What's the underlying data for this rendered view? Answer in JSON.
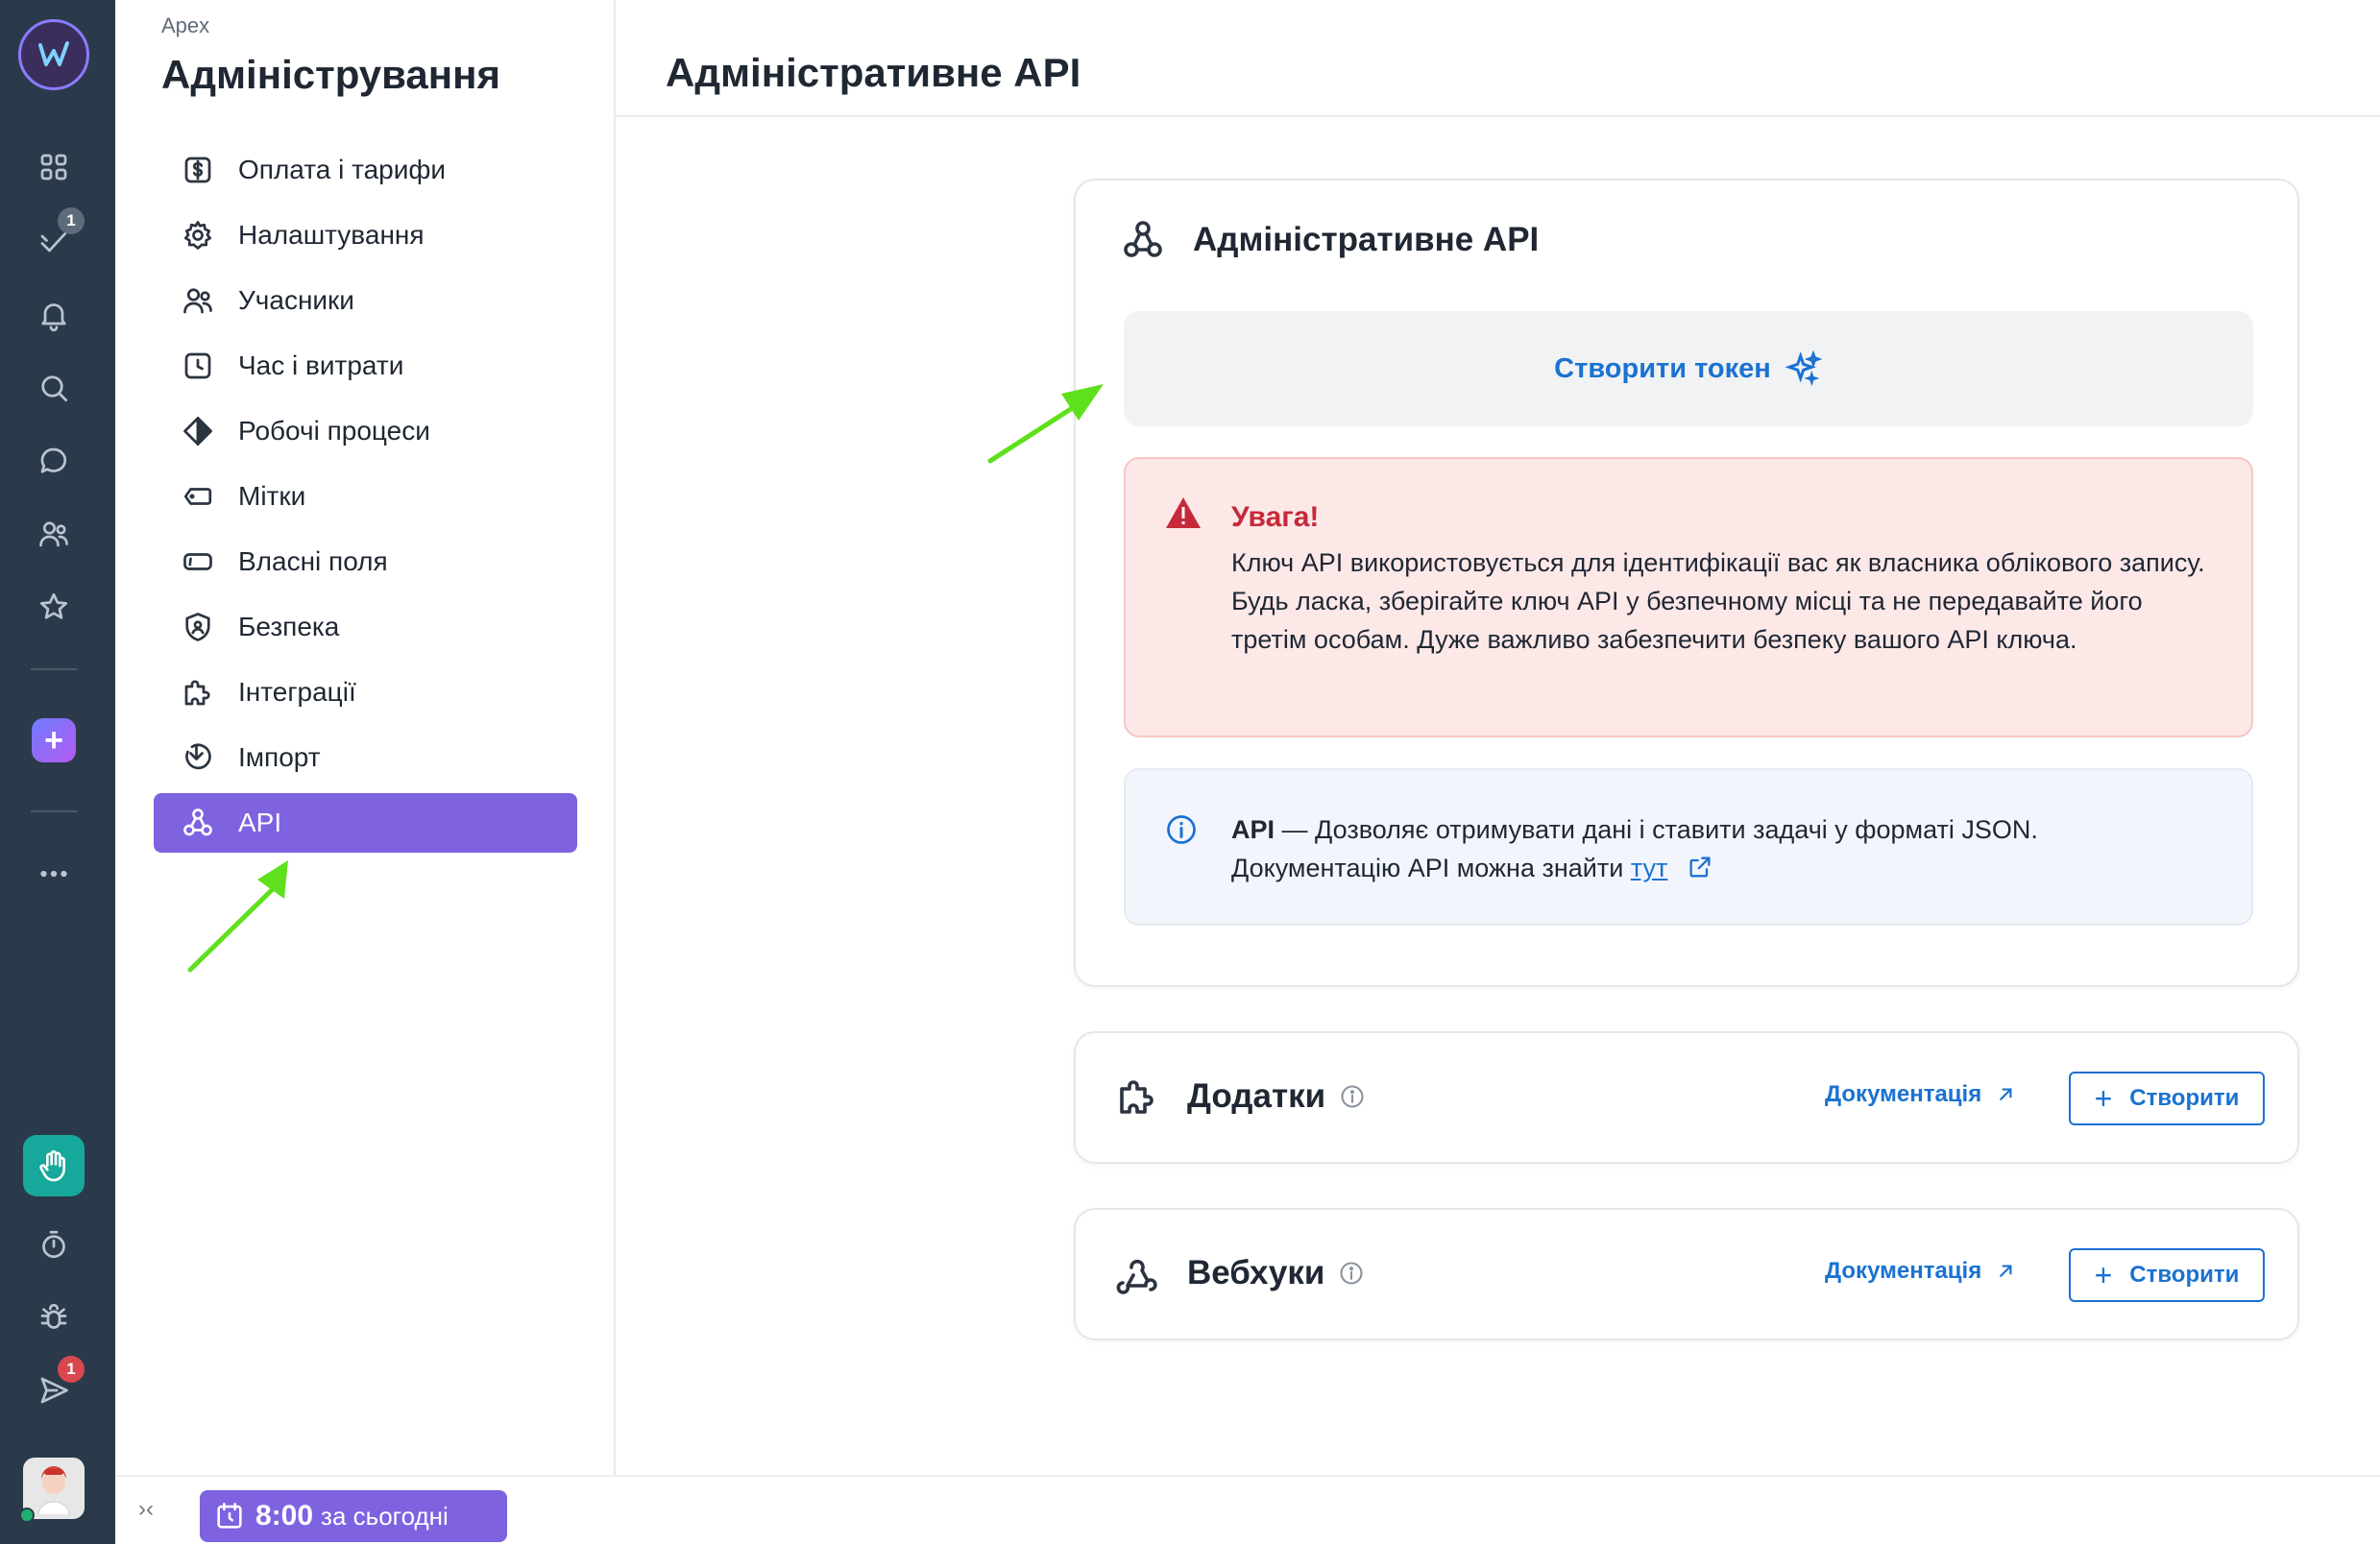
{
  "rail": {
    "badge_tasks": "1",
    "badge_inbox": "1"
  },
  "sidebar": {
    "workspace": "Apex",
    "title": "Адміністрування",
    "items": [
      {
        "label": "Оплата і тарифи",
        "icon": "dollar-icon"
      },
      {
        "label": "Налаштування",
        "icon": "gear-icon"
      },
      {
        "label": "Учасники",
        "icon": "users-icon"
      },
      {
        "label": "Час і витрати",
        "icon": "clock-icon"
      },
      {
        "label": "Робочі процеси",
        "icon": "workflow-icon"
      },
      {
        "label": "Мітки",
        "icon": "tag-icon"
      },
      {
        "label": "Власні поля",
        "icon": "field-icon"
      },
      {
        "label": "Безпека",
        "icon": "shield-icon"
      },
      {
        "label": "Інтеграції",
        "icon": "puzzle-icon"
      },
      {
        "label": "Імпорт",
        "icon": "import-icon"
      },
      {
        "label": "API",
        "icon": "api-icon"
      }
    ],
    "active_item": "API"
  },
  "bottombar": {
    "collapse": "›‹",
    "timer_value": "8:00",
    "timer_suffix": "за сьогодні"
  },
  "main": {
    "header_title": "Адміністративне API",
    "api_card": {
      "title": "Адміністративне API",
      "token_button": "Створити токен",
      "warning_title": "Увага!",
      "warning_text": "Ключ API використовується для ідентифікації вас як власника облікового запису. Будь ласка, зберігайте ключ API у безпечному місці та не передавайте його третім особам. Дуже важливо забезпечити безпеку вашого API ключа.",
      "info_bold": "API",
      "info_text_1": " — Дозволяє отримувати дані і ставити задачі у форматі JSON.",
      "info_text_2": "Документацію API можна знайти ",
      "info_link": "тут"
    },
    "apps_card": {
      "title": "Додатки",
      "doc_link": "Документація",
      "create_button": "Створити"
    },
    "webhooks_card": {
      "title": "Вебхуки",
      "doc_link": "Документація",
      "create_button": "Створити"
    }
  },
  "colors": {
    "accent": "#7e62e0",
    "link": "#1a72d1",
    "rail": "#2b3a4a",
    "warning_bg": "#fde8e8",
    "warning_title": "#c62a3a",
    "arrow": "#5fe01d"
  }
}
